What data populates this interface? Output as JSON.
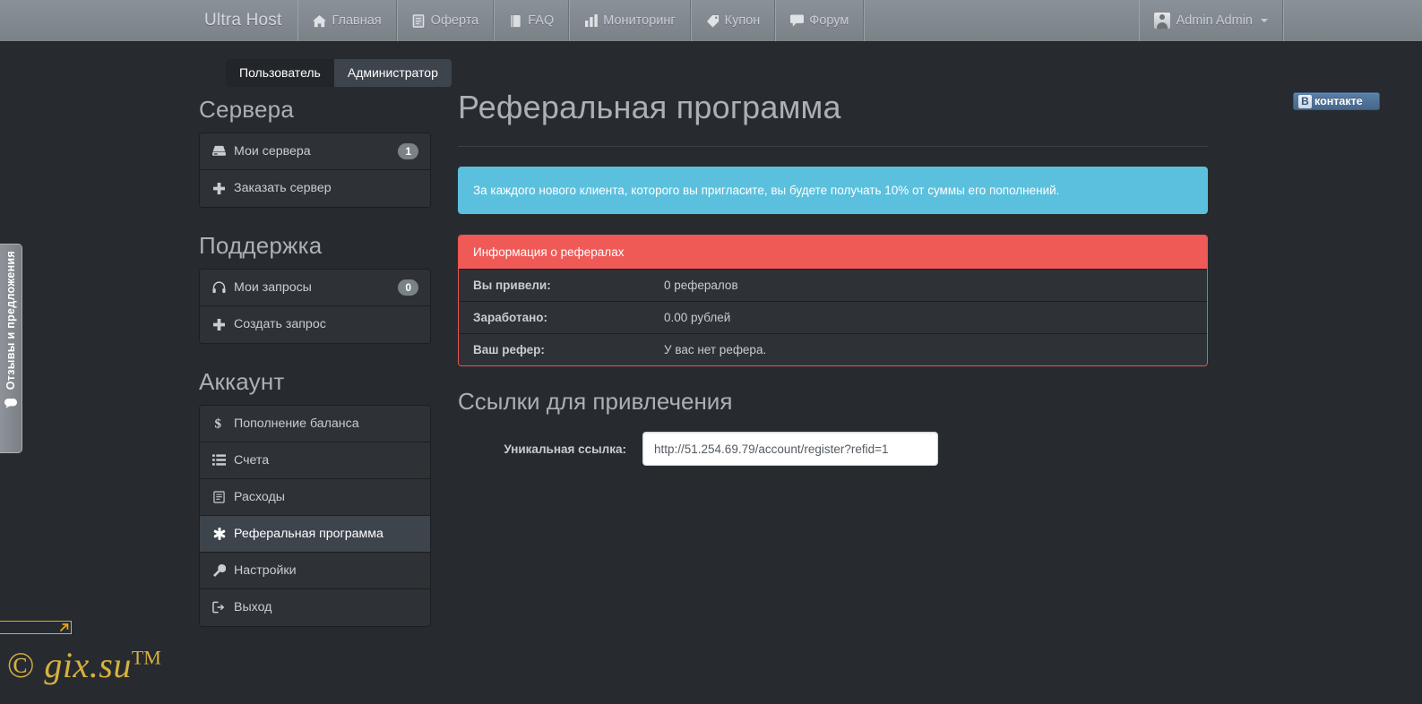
{
  "navbar": {
    "brand": "Ultra Host",
    "items": [
      {
        "label": "Главная",
        "icon": "home-icon"
      },
      {
        "label": "Оферта",
        "icon": "document-icon"
      },
      {
        "label": "FAQ",
        "icon": "book-icon"
      },
      {
        "label": "Мониторинг",
        "icon": "bar-chart-icon"
      },
      {
        "label": "Купон",
        "icon": "tag-icon"
      },
      {
        "label": "Форум",
        "icon": "comment-icon"
      }
    ],
    "user": {
      "label": "Admin Admin",
      "icon": "user-avatar-icon",
      "caret": "caret-down-icon"
    }
  },
  "tabs": [
    {
      "label": "Пользователь",
      "active": false
    },
    {
      "label": "Администратор",
      "active": true
    }
  ],
  "sidebar": {
    "groups": [
      {
        "heading": "Сервера",
        "items": [
          {
            "label": "Мои сервера",
            "icon": "server-icon",
            "badge": "1",
            "active": false
          },
          {
            "label": "Заказать сервер",
            "icon": "plus-icon",
            "badge": null,
            "active": false
          }
        ]
      },
      {
        "heading": "Поддержка",
        "items": [
          {
            "label": "Мои запросы",
            "icon": "headphones-icon",
            "badge": "0",
            "active": false
          },
          {
            "label": "Создать запрос",
            "icon": "plus-icon",
            "badge": null,
            "active": false
          }
        ]
      },
      {
        "heading": "Аккаунт",
        "items": [
          {
            "label": "Пополнение баланса",
            "icon": "dollar-icon",
            "badge": null,
            "active": false
          },
          {
            "label": "Счета",
            "icon": "list-icon",
            "badge": null,
            "active": false
          },
          {
            "label": "Расходы",
            "icon": "document-icon",
            "badge": null,
            "active": false
          },
          {
            "label": "Реферальная программа",
            "icon": "asterisk-icon",
            "badge": null,
            "active": true
          },
          {
            "label": "Настройки",
            "icon": "wrench-icon",
            "badge": null,
            "active": false
          },
          {
            "label": "Выход",
            "icon": "logout-icon",
            "badge": null,
            "active": false
          }
        ]
      }
    ]
  },
  "main": {
    "page_title": "Реферальная программа",
    "alert": "За каждого нового клиента, которого вы пригласите, вы будете получать 10% от суммы его пополнений.",
    "panel": {
      "heading": "Информация о рефералах",
      "rows": [
        {
          "key": "Вы привели:",
          "value": "0 рефералов"
        },
        {
          "key": "Заработано:",
          "value": "0.00 рублей"
        },
        {
          "key": "Ваш рефер:",
          "value": "У вас нет рефера."
        }
      ]
    },
    "links_section": {
      "title": "Ссылки для привлечения",
      "field_label": "Уникальная ссылка:",
      "field_value": "http://51.254.69.79/account/register?refid=1"
    }
  },
  "vk_widget": {
    "badge": "В",
    "label": "контакте"
  },
  "feedback_tab": {
    "label": "Отзывы и предложения",
    "icon": "speech-bubble-icon"
  },
  "watermark": {
    "copyright": "©",
    "text": " gix.su",
    "tm": "TM"
  },
  "colors": {
    "page_bg": "#272b30",
    "navbar": "#7a8288",
    "panel_bg": "#2e3236",
    "alert_info": "#5bc0de",
    "panel_danger": "#f05a56",
    "active_item": "#3e444c",
    "text_muted": "#c8cdd2",
    "heading": "#aab0b6",
    "watermark_gold": "#d6b13e"
  }
}
